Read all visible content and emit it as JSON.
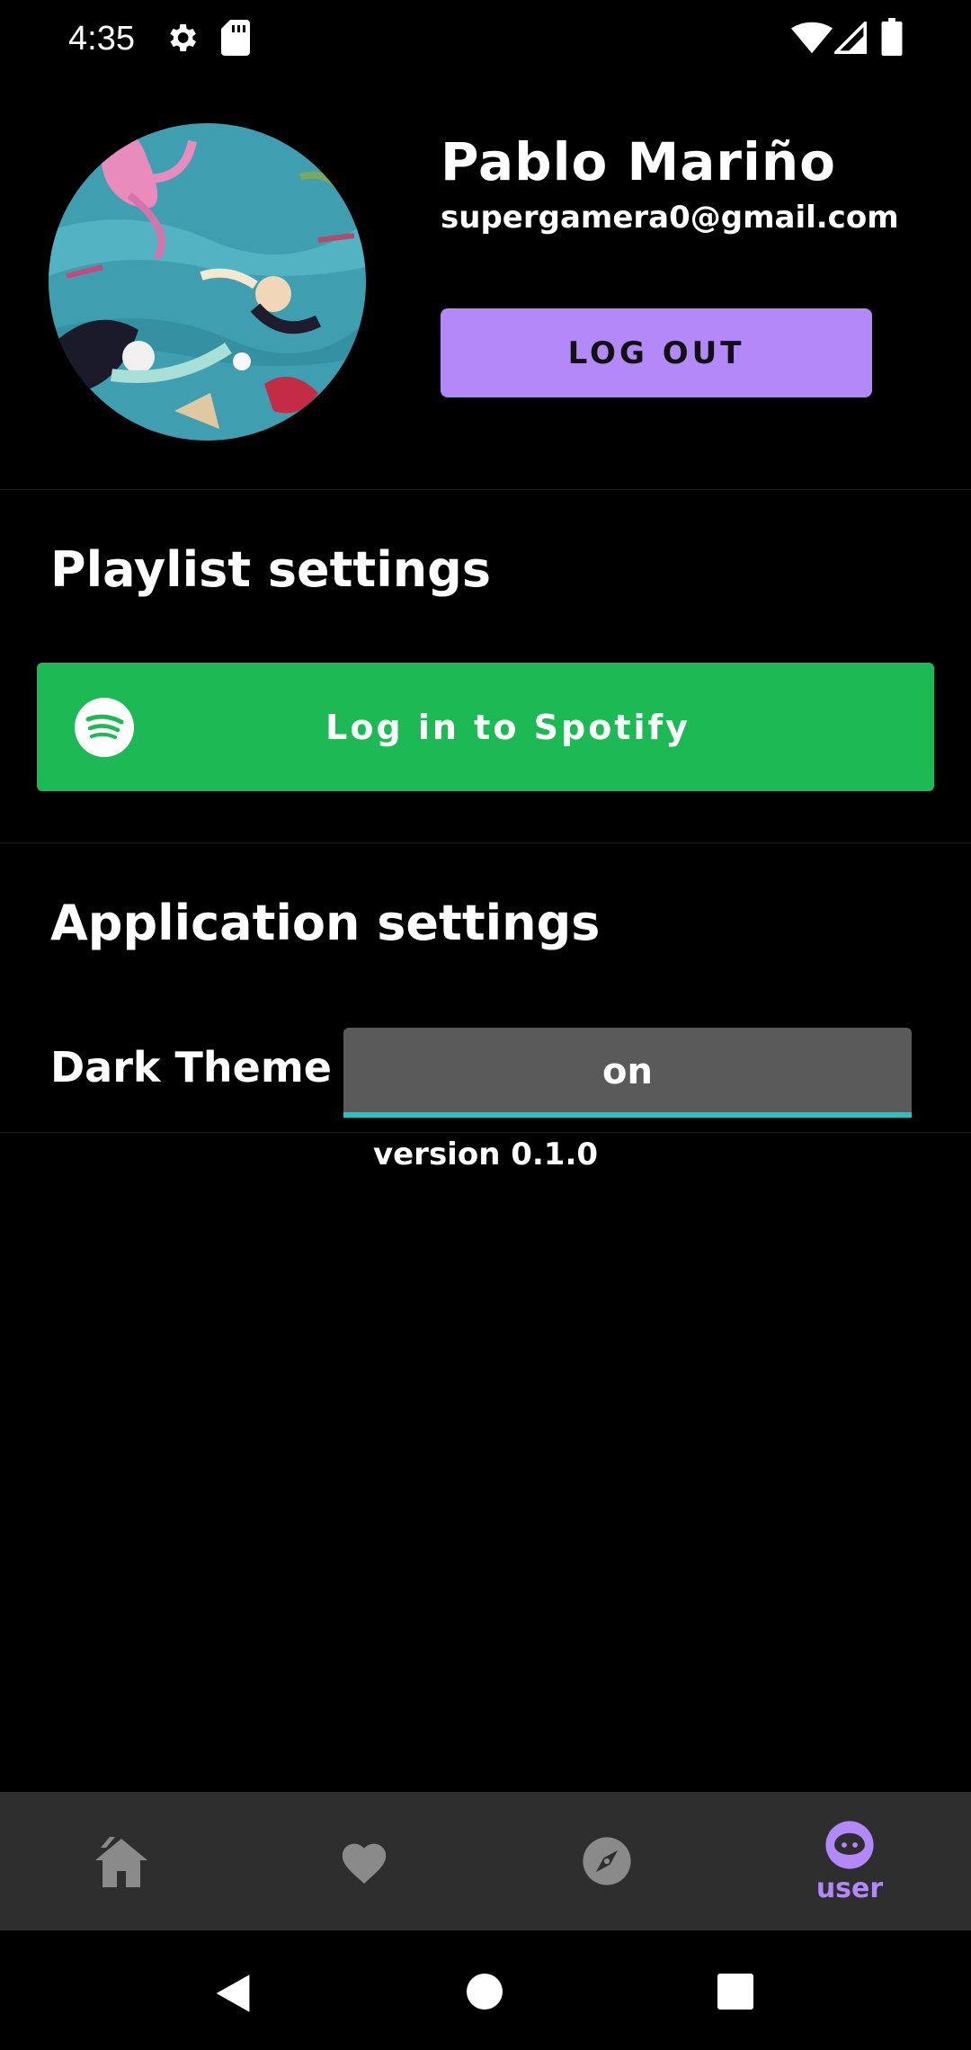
{
  "status_bar": {
    "time": "4:35",
    "icons": [
      "gear-icon",
      "sd-card-icon",
      "wifi-icon",
      "signal-icon",
      "battery-icon"
    ]
  },
  "profile": {
    "name": "Pablo Mariño",
    "email": "supergamera0@gmail.com",
    "logout_label": "LOG OUT",
    "logout_color": "#b388f8"
  },
  "playlist_settings": {
    "title": "Playlist settings",
    "spotify_button_label": "Log in to Spotify",
    "spotify_color": "#1db954"
  },
  "application_settings": {
    "title": "Application settings",
    "dark_theme_label": "Dark Theme",
    "dark_theme_value": "on"
  },
  "version": "version 0.1.0",
  "bottom_nav": {
    "items": [
      {
        "icon": "home-icon",
        "label": ""
      },
      {
        "icon": "heart-icon",
        "label": ""
      },
      {
        "icon": "compass-icon",
        "label": ""
      },
      {
        "icon": "user-icon",
        "label": "user",
        "active": true
      }
    ],
    "active_color": "#b388f8"
  },
  "system_nav": {
    "icons": [
      "back-icon",
      "home-circle-icon",
      "recents-icon"
    ]
  }
}
